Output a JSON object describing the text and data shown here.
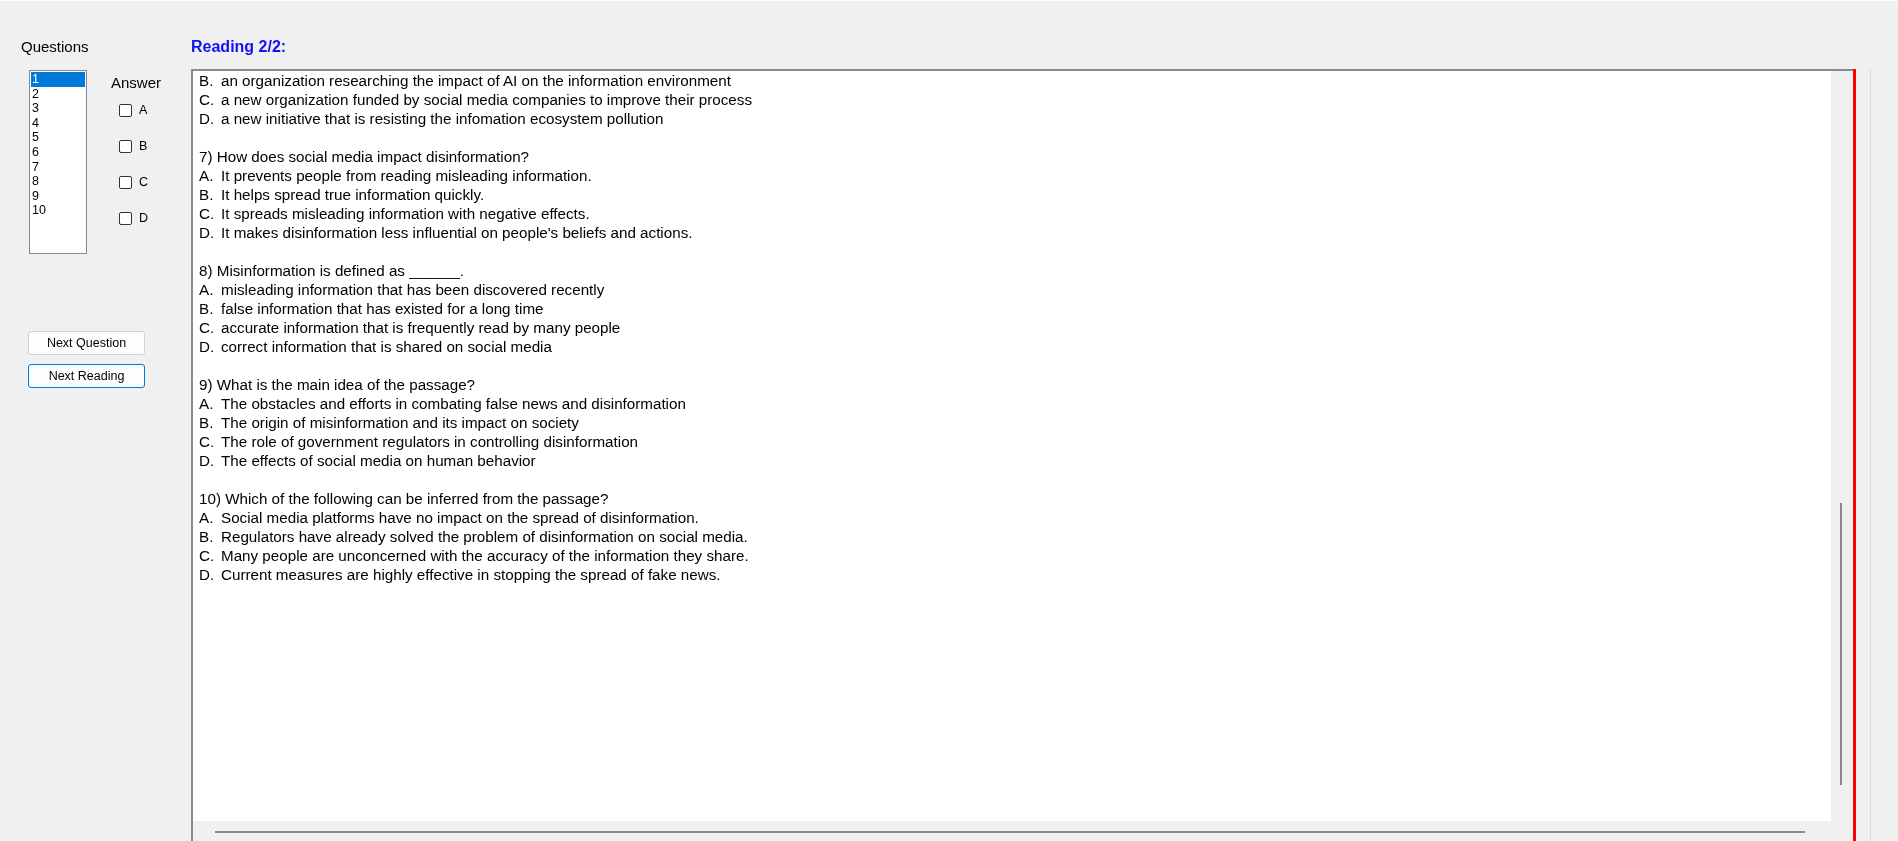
{
  "questions_label": "Questions",
  "question_list": [
    {
      "label": "1",
      "selected": true
    },
    {
      "label": "2",
      "selected": false
    },
    {
      "label": "3",
      "selected": false
    },
    {
      "label": "4",
      "selected": false
    },
    {
      "label": "5",
      "selected": false
    },
    {
      "label": "6",
      "selected": false
    },
    {
      "label": "7",
      "selected": false
    },
    {
      "label": "8",
      "selected": false
    },
    {
      "label": "9",
      "selected": false
    },
    {
      "label": "10",
      "selected": false
    }
  ],
  "answer_label": "Answer",
  "answers": [
    {
      "label": "A",
      "checked": false
    },
    {
      "label": "B",
      "checked": false
    },
    {
      "label": "C",
      "checked": false
    },
    {
      "label": "D",
      "checked": false
    }
  ],
  "buttons": [
    {
      "label": "Next Question",
      "focused": false
    },
    {
      "label": "Next Reading",
      "focused": true
    }
  ],
  "reading_title": "Reading 2/2:",
  "reading_blocks": [
    {
      "options": [
        {
          "letter": "B.",
          "text": "an organization researching the impact of AI on the information environment"
        },
        {
          "letter": "C.",
          "text": "a new organization funded by social media companies to improve their process"
        },
        {
          "letter": "D.",
          "text": "a new initiative that is resisting the infomation ecosystem pollution"
        }
      ]
    },
    {
      "question": "7) How does social media impact disinformation?",
      "options": [
        {
          "letter": "A.",
          "text": "It prevents people from reading misleading information."
        },
        {
          "letter": "B.",
          "text": "It helps spread true information quickly."
        },
        {
          "letter": "C.",
          "text": "It spreads misleading information with negative effects."
        },
        {
          "letter": "D.",
          "text": "It makes disinformation less influential on people's beliefs and actions."
        }
      ]
    },
    {
      "question": "8) Misinformation is defined as ______.",
      "options": [
        {
          "letter": "A.",
          "text": "misleading information that has been discovered recently"
        },
        {
          "letter": "B.",
          "text": "false information that has existed for a long time"
        },
        {
          "letter": "C.",
          "text": "accurate information that is frequently read by many people"
        },
        {
          "letter": "D.",
          "text": "correct information that is shared on social media"
        }
      ]
    },
    {
      "question": "9) What is the main idea of the passage?",
      "options": [
        {
          "letter": "A.",
          "text": "The obstacles and efforts in combating false news and disinformation"
        },
        {
          "letter": "B.",
          "text": "The origin of misinformation and its impact on society"
        },
        {
          "letter": "C.",
          "text": "The role of government regulators in controlling disinformation"
        },
        {
          "letter": "D.",
          "text": "The effects of social media on human behavior"
        }
      ]
    },
    {
      "question": "10) Which of the following can be inferred from the passage?",
      "options": [
        {
          "letter": "A.",
          "text": "Social media platforms have no impact on the spread of disinformation."
        },
        {
          "letter": "B.",
          "text": "Regulators have already solved the problem of disinformation on social media."
        },
        {
          "letter": "C.",
          "text": "Many people are unconcerned with the accuracy of the information they share."
        },
        {
          "letter": "D.",
          "text": "Current measures are highly effective in stopping the spread of fake news."
        }
      ]
    }
  ]
}
